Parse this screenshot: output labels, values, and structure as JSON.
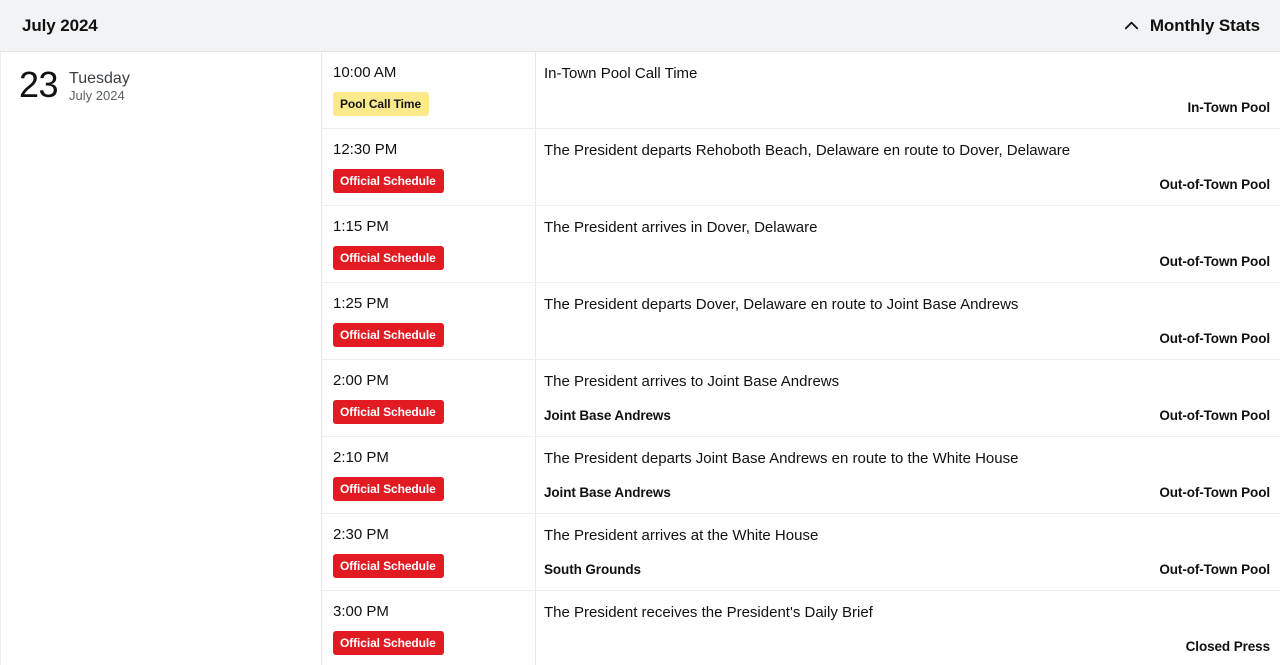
{
  "header": {
    "title": "July 2024",
    "stats_toggle_label": "Monthly Stats",
    "chevron_icon": "chevron-up-icon"
  },
  "day": {
    "number": "23",
    "weekday": "Tuesday",
    "month_year": "July 2024"
  },
  "colors": {
    "badge_official_bg": "#e21b23",
    "badge_official_text": "#ffffff",
    "badge_pool_bg": "#fbe98c",
    "badge_pool_text": "#161616",
    "header_bg": "#f2f3f5",
    "divider": "#eceef0"
  },
  "events": [
    {
      "time": "10:00 AM",
      "badge": "Pool Call Time",
      "badge_type": "pool",
      "description": "In-Town Pool Call Time",
      "location": "",
      "coverage": "In-Town Pool"
    },
    {
      "time": "12:30 PM",
      "badge": "Official Schedule",
      "badge_type": "official",
      "description": "The President departs Rehoboth Beach, Delaware en route to Dover, Delaware",
      "location": "",
      "coverage": "Out-of-Town Pool"
    },
    {
      "time": "1:15 PM",
      "badge": "Official Schedule",
      "badge_type": "official",
      "description": "The President arrives in Dover, Delaware",
      "location": "",
      "coverage": "Out-of-Town Pool"
    },
    {
      "time": "1:25 PM",
      "badge": "Official Schedule",
      "badge_type": "official",
      "description": "The President departs Dover, Delaware en route to Joint Base Andrews",
      "location": "",
      "coverage": "Out-of-Town Pool"
    },
    {
      "time": "2:00 PM",
      "badge": "Official Schedule",
      "badge_type": "official",
      "description": "The President arrives to Joint Base Andrews",
      "location": "Joint Base Andrews",
      "coverage": "Out-of-Town Pool"
    },
    {
      "time": "2:10 PM",
      "badge": "Official Schedule",
      "badge_type": "official",
      "description": "The President departs Joint Base Andrews en route to the White House",
      "location": "Joint Base Andrews",
      "coverage": "Out-of-Town Pool"
    },
    {
      "time": "2:30 PM",
      "badge": "Official Schedule",
      "badge_type": "official",
      "description": "The President arrives at the White House",
      "location": "South Grounds",
      "coverage": "Out-of-Town Pool"
    },
    {
      "time": "3:00 PM",
      "badge": "Official Schedule",
      "badge_type": "official",
      "description": "The President receives the President's Daily Brief",
      "location": "",
      "coverage": "Closed Press"
    }
  ]
}
